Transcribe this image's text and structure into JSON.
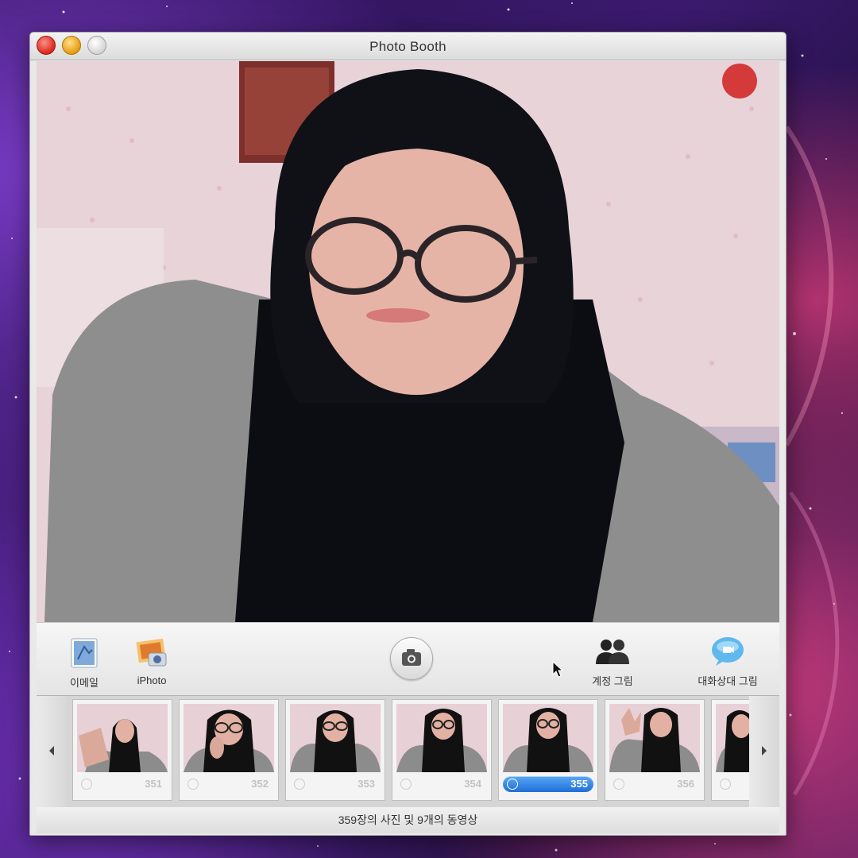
{
  "window": {
    "title": "Photo Booth"
  },
  "toolbar": {
    "email_label": "이메일",
    "iphoto_label": "iPhoto",
    "account_picture_label": "계정 그림",
    "buddy_picture_label": "대화상대 그림"
  },
  "thumbnails": [
    {
      "number": "351"
    },
    {
      "number": "352"
    },
    {
      "number": "353"
    },
    {
      "number": "354"
    },
    {
      "number": "355"
    },
    {
      "number": "356"
    },
    {
      "number": ""
    }
  ],
  "status": {
    "text": "359장의 사진 및 9개의 동영상"
  },
  "colors": {
    "selection": "#2f7fe0",
    "window_bg": "#e9e9e9",
    "close": "#d8261c",
    "minimize": "#e59a11"
  },
  "icons": [
    "email-icon",
    "iphoto-icon",
    "camera-icon",
    "account-picture-icon",
    "buddy-picture-icon",
    "arrow-left-icon",
    "arrow-right-icon",
    "cursor-icon"
  ]
}
